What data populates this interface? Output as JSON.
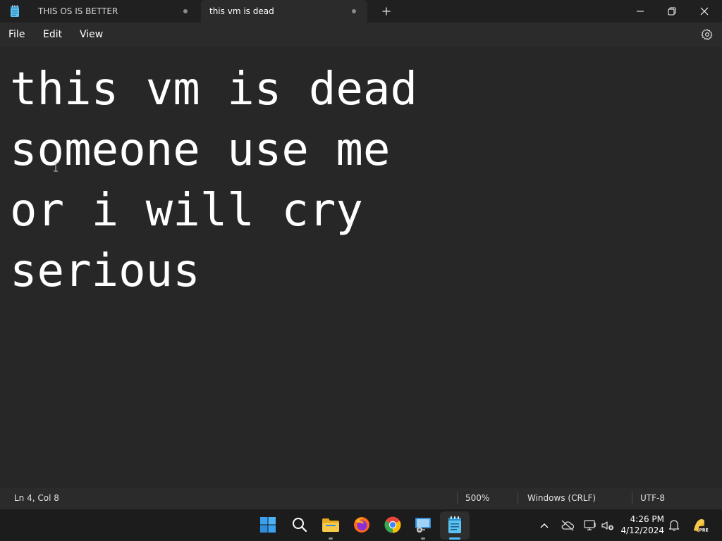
{
  "window": {
    "tabs": [
      {
        "label": "THIS OS IS BETTER",
        "active": false
      },
      {
        "label": "this vm is dead",
        "active": true
      }
    ]
  },
  "menu": {
    "file": "File",
    "edit": "Edit",
    "view": "View"
  },
  "editor": {
    "lines": [
      "this vm is dead",
      "someone use me",
      "or i will cry",
      "serious"
    ]
  },
  "status": {
    "position": "Ln 4, Col 8",
    "zoom": "500%",
    "line_ending": "Windows (CRLF)",
    "encoding": "UTF-8"
  },
  "taskbar": {
    "apps": [
      "start-icon",
      "search-icon",
      "file-explorer-icon",
      "firefox-icon",
      "chrome-icon",
      "remote-desktop-icon",
      "notepad-icon"
    ],
    "tray_badge": "PRE"
  },
  "clock": {
    "time": "4:26 PM",
    "date": "4/12/2024"
  },
  "colors": {
    "background": "#202020",
    "editor_background": "#272727",
    "accent": "#4cc2ff"
  }
}
